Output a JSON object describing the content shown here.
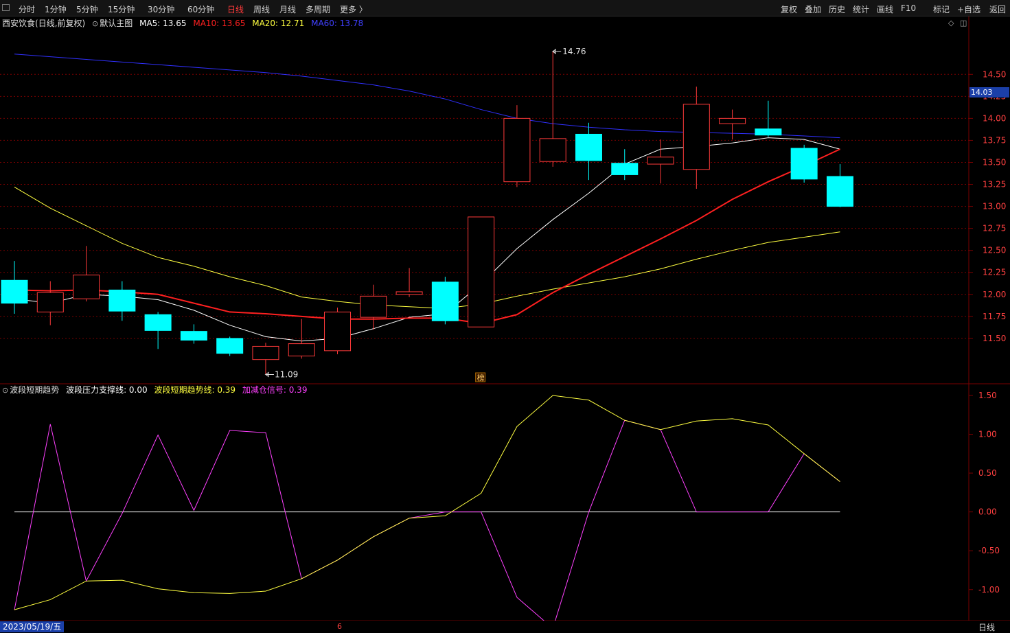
{
  "toolbar": {
    "left_tabs": [
      "分时",
      "1分钟",
      "5分钟",
      "15分钟",
      "30分钟",
      "60分钟",
      "日线",
      "周线",
      "月线",
      "多周期",
      "更多 〉"
    ],
    "active_tab": "日线",
    "right_tabs": [
      "复权",
      "叠加",
      "历史",
      "统计",
      "画线",
      "F10",
      "标记",
      "+自选",
      "返回"
    ]
  },
  "main_panel": {
    "stock_name": "西安饮食",
    "mode": "(日线,前复权)",
    "template": "默认主图",
    "ma5": "MA5: 13.65",
    "ma10": "MA10: 13.65",
    "ma20": "MA20: 12.71",
    "ma60": "MA60: 13.78",
    "high_label": "14.76",
    "low_label": "11.09",
    "last_price": "14.03",
    "marker_text": "榜"
  },
  "indicator_panel": {
    "name": "波段短期趋势",
    "line1": "波段压力支撑线: 0.00",
    "line2": "波段短期趋势线: 0.39",
    "line3": "加减仓信号: 0.39"
  },
  "footer": {
    "date": "2023/05/19/五",
    "month_mark": "6",
    "period_tab": "日线"
  },
  "colors": {
    "up": "#ff3a3a",
    "down": "#00ffff",
    "ma5": "#ffffff",
    "ma10": "#ff2020",
    "ma20": "#ffff40",
    "ma60": "#3030ff",
    "signal": "#ff40ff",
    "trend": "#ffff40",
    "grid": "#7a0000",
    "axis_text": "#ff4040"
  },
  "chart_data": [
    {
      "type": "candlestick",
      "title": "西安饮食 (日线,前复权)",
      "y_ticks": [
        11.5,
        11.75,
        12.0,
        12.25,
        12.5,
        12.75,
        13.0,
        13.25,
        13.5,
        13.75,
        14.0,
        14.25,
        14.5
      ],
      "ylim": [
        11.0,
        14.9
      ],
      "candles": [
        {
          "o": 12.16,
          "h": 12.38,
          "l": 11.78,
          "c": 11.9
        },
        {
          "o": 11.8,
          "h": 12.15,
          "l": 11.65,
          "c": 12.02
        },
        {
          "o": 11.95,
          "h": 12.55,
          "l": 11.92,
          "c": 12.22
        },
        {
          "o": 12.05,
          "h": 12.15,
          "l": 11.7,
          "c": 11.81
        },
        {
          "o": 11.77,
          "h": 11.8,
          "l": 11.38,
          "c": 11.59
        },
        {
          "o": 11.58,
          "h": 11.66,
          "l": 11.44,
          "c": 11.48
        },
        {
          "o": 11.5,
          "h": 11.52,
          "l": 11.3,
          "c": 11.33
        },
        {
          "o": 11.26,
          "h": 11.45,
          "l": 11.09,
          "c": 11.41
        },
        {
          "o": 11.3,
          "h": 11.72,
          "l": 11.27,
          "c": 11.44
        },
        {
          "o": 11.36,
          "h": 11.85,
          "l": 11.32,
          "c": 11.8
        },
        {
          "o": 11.74,
          "h": 12.11,
          "l": 11.6,
          "c": 11.98
        },
        {
          "o": 12.0,
          "h": 12.3,
          "l": 11.97,
          "c": 12.03
        },
        {
          "o": 12.14,
          "h": 12.2,
          "l": 11.66,
          "c": 11.7
        },
        {
          "o": 11.63,
          "h": 12.88,
          "l": 11.63,
          "c": 12.88
        },
        {
          "o": 13.28,
          "h": 14.15,
          "l": 13.22,
          "c": 14.0
        },
        {
          "o": 13.51,
          "h": 14.76,
          "l": 13.45,
          "c": 13.77
        },
        {
          "o": 13.82,
          "h": 13.95,
          "l": 13.3,
          "c": 13.52
        },
        {
          "o": 13.49,
          "h": 13.65,
          "l": 13.3,
          "c": 13.36
        },
        {
          "o": 13.48,
          "h": 13.76,
          "l": 13.26,
          "c": 13.56
        },
        {
          "o": 13.42,
          "h": 14.36,
          "l": 13.2,
          "c": 14.16
        },
        {
          "o": 13.94,
          "h": 14.1,
          "l": 13.76,
          "c": 14.0
        },
        {
          "o": 13.88,
          "h": 14.2,
          "l": 13.79,
          "c": 13.81
        },
        {
          "o": 13.66,
          "h": 13.7,
          "l": 13.27,
          "c": 13.31
        },
        {
          "o": 13.34,
          "h": 13.48,
          "l": 12.99,
          "c": 13.0
        }
      ],
      "series": [
        {
          "name": "MA5",
          "values": [
            11.95,
            11.9,
            12.0,
            11.98,
            11.94,
            11.82,
            11.65,
            11.52,
            11.47,
            11.5,
            11.61,
            11.74,
            11.78,
            12.12,
            12.52,
            12.85,
            13.15,
            13.48,
            13.65,
            13.68,
            13.72,
            13.78,
            13.76,
            13.65
          ]
        },
        {
          "name": "MA10",
          "values": [
            12.05,
            12.04,
            12.05,
            12.03,
            12.0,
            11.9,
            11.8,
            11.78,
            11.75,
            11.72,
            11.72,
            11.73,
            11.73,
            11.67,
            11.77,
            12.02,
            12.23,
            12.43,
            12.63,
            12.84,
            13.08,
            13.28,
            13.46,
            13.65
          ]
        },
        {
          "name": "MA20",
          "values": [
            13.22,
            12.98,
            12.78,
            12.58,
            12.42,
            12.32,
            12.2,
            12.1,
            11.97,
            11.92,
            11.88,
            11.86,
            11.84,
            11.89,
            11.98,
            12.06,
            12.13,
            12.2,
            12.29,
            12.4,
            12.5,
            12.59,
            12.65,
            12.71
          ]
        },
        {
          "name": "MA60",
          "values": [
            14.73,
            14.7,
            14.67,
            14.64,
            14.61,
            14.58,
            14.55,
            14.52,
            14.48,
            14.43,
            14.38,
            14.31,
            14.22,
            14.1,
            14.0,
            13.94,
            13.9,
            13.87,
            13.85,
            13.84,
            13.83,
            13.82,
            13.8,
            13.78
          ]
        }
      ]
    },
    {
      "type": "line",
      "title": "波段短期趋势",
      "y_ticks": [
        -1.0,
        -0.5,
        0.0,
        0.5,
        1.0,
        1.5
      ],
      "ylim": [
        -1.4,
        1.65
      ],
      "series": [
        {
          "name": "波段压力支撑线",
          "values": [
            0,
            0,
            0,
            0,
            0,
            0,
            0,
            0,
            0,
            0,
            0,
            0,
            0,
            0,
            0,
            0,
            0,
            0,
            0,
            0,
            0,
            0,
            0,
            0
          ]
        },
        {
          "name": "波段短期趋势线",
          "values": [
            -1.26,
            -1.13,
            -0.89,
            -0.88,
            -0.99,
            -1.04,
            -1.05,
            -1.02,
            -0.86,
            -0.62,
            -0.32,
            -0.08,
            -0.05,
            0.24,
            1.1,
            1.5,
            1.44,
            1.18,
            1.06,
            1.17,
            1.2,
            1.12,
            0.75,
            0.39
          ]
        },
        {
          "name": "加减仓信号",
          "values": [
            -1.26,
            1.13,
            -0.89,
            -0.02,
            0.99,
            0.02,
            1.05,
            1.02,
            -0.86,
            -0.62,
            -0.32,
            -0.08,
            0.0,
            0.0,
            -1.1,
            -1.5,
            0.0,
            1.18,
            1.06,
            0.0,
            0.0,
            0.0,
            0.75,
            0.39
          ]
        }
      ]
    }
  ]
}
